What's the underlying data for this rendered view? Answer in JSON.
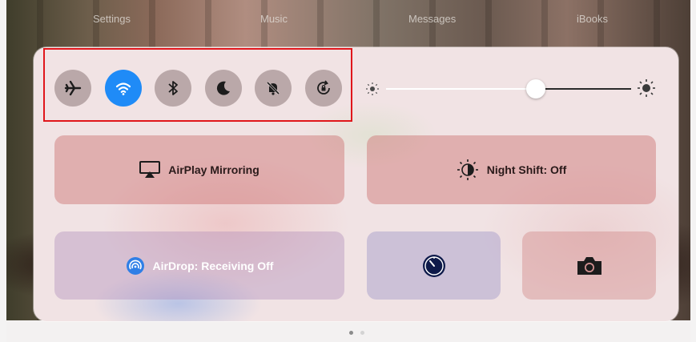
{
  "dock": {
    "apps": [
      "Settings",
      "Music",
      "Messages",
      "iBooks"
    ]
  },
  "control_center": {
    "toggles": [
      {
        "name": "Airplane Mode",
        "icon": "airplane-icon",
        "on": false
      },
      {
        "name": "Wi-Fi",
        "icon": "wifi-icon",
        "on": true
      },
      {
        "name": "Bluetooth",
        "icon": "bluetooth-icon",
        "on": false
      },
      {
        "name": "Do Not Disturb",
        "icon": "moon-icon",
        "on": false
      },
      {
        "name": "Silent",
        "icon": "bell-slash-icon",
        "on": false
      },
      {
        "name": "Rotation Lock",
        "icon": "rotation-lock-icon",
        "on": false
      }
    ],
    "brightness": {
      "level": 0.62
    },
    "buttons": {
      "airplay": "AirPlay Mirroring",
      "night_shift": "Night Shift: Off",
      "airdrop": "AirDrop: Receiving Off"
    },
    "page_indicator": {
      "count": 2,
      "current": 1
    }
  },
  "colors": {
    "accent": "#1f8bf7",
    "highlight_box": "#e0161b"
  }
}
